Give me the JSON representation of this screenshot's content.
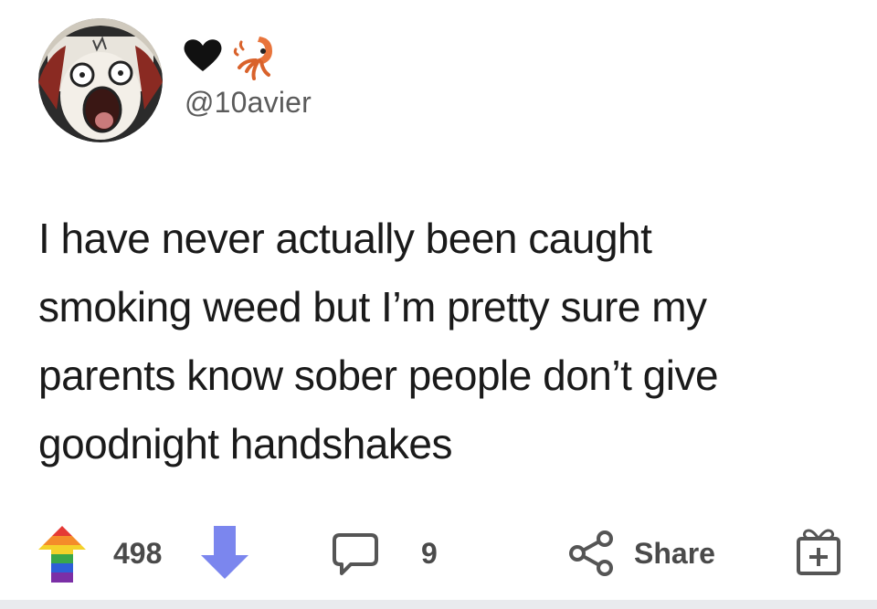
{
  "author": {
    "handle": "@10avier",
    "name_emojis": [
      "black-heart-emoji",
      "squid-emoji"
    ]
  },
  "post": {
    "lines": [
      "I have never actually been caught",
      "smoking weed but I’m pretty sure my",
      "parents know sober people don’t give",
      "goodnight handshakes"
    ]
  },
  "actions": {
    "upvote_count": "498",
    "comment_count": "9",
    "share_label": "Share"
  },
  "colors": {
    "downvote": "#7b86ee",
    "text": "#1a1a1a",
    "handle": "#5b5b5b",
    "icon_gray": "#555555"
  }
}
